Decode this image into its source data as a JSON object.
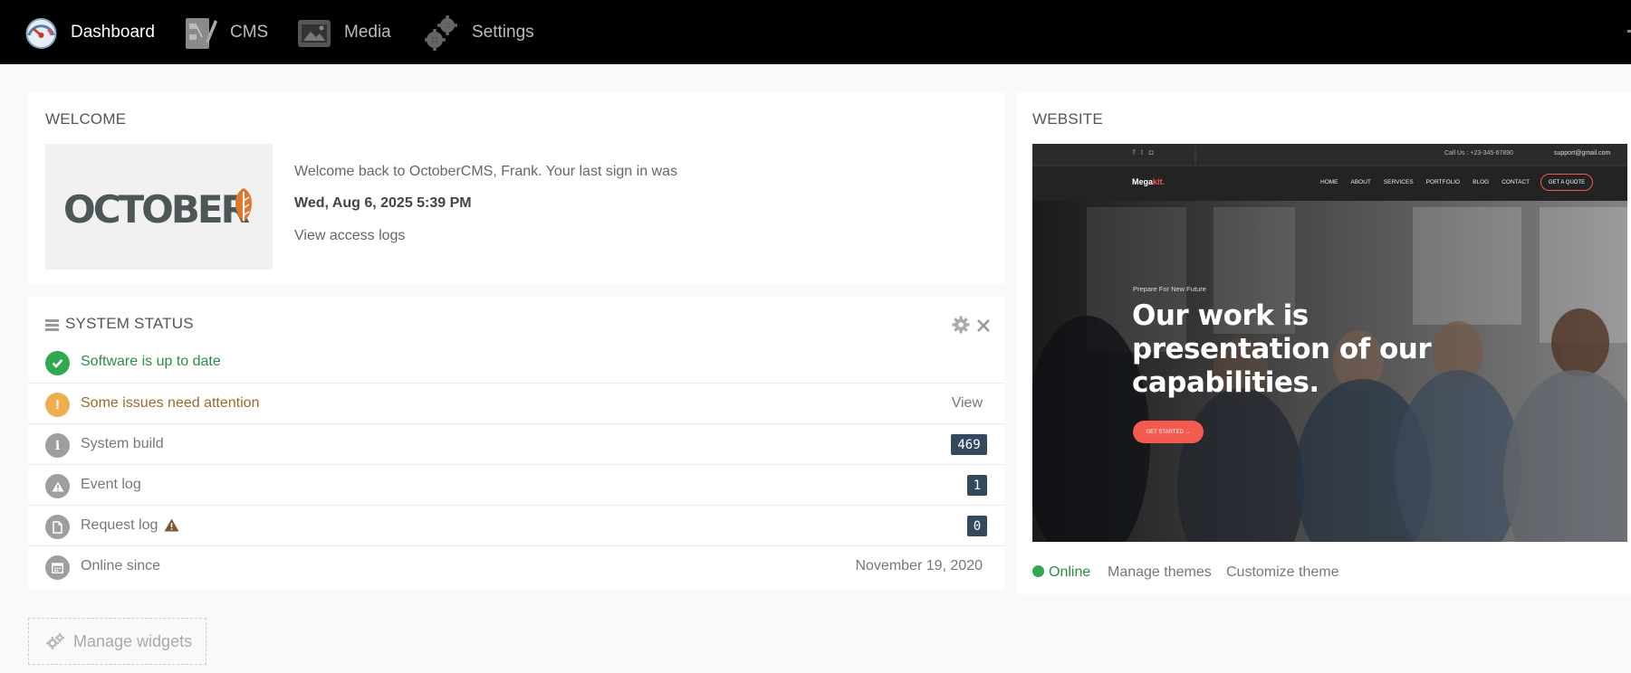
{
  "nav": {
    "items": [
      {
        "label": "Dashboard",
        "icon": "speedometer-icon"
      },
      {
        "label": "CMS",
        "icon": "cms-icon"
      },
      {
        "label": "Media",
        "icon": "media-icon"
      },
      {
        "label": "Settings",
        "icon": "gears-icon"
      }
    ]
  },
  "welcome": {
    "title": "WELCOME",
    "logo_text": "OCTOBER",
    "message": "Welcome back to OctoberCMS, Frank. Your last sign in was",
    "last_signin": "Wed, Aug 6, 2025 5:39 PM",
    "access_logs_link": "View access logs"
  },
  "system_status": {
    "title": "SYSTEM STATUS",
    "rows": [
      {
        "label": "Software is up to date",
        "icon": "check-icon"
      },
      {
        "label": "Some issues need attention",
        "icon": "exclamation-icon",
        "right": "View"
      },
      {
        "label": "System build",
        "icon": "info-icon",
        "badge": "469"
      },
      {
        "label": "Event log",
        "icon": "warning-icon",
        "badge": "1"
      },
      {
        "label": "Request log",
        "icon": "file-icon",
        "badge": "0"
      },
      {
        "label": "Online since",
        "icon": "calendar-icon",
        "right": "November 19, 2020"
      }
    ]
  },
  "website": {
    "title": "WEBSITE",
    "preview": {
      "contact_phone": "Call Us : +23-345-67890",
      "contact_email": "support@gmail.com",
      "brand_a": "Mega",
      "brand_b": "kit.",
      "menu": [
        "HOME",
        "ABOUT",
        "SERVICES",
        "PORTFOLIO",
        "BLOG",
        "CONTACT"
      ],
      "cta": "GET A QUOTE",
      "kicker": "Prepare For New Future",
      "headline_1": "Our work is",
      "headline_2": "presentation of our",
      "headline_3": "capabilities.",
      "button": "GET STARTED →"
    },
    "status": "Online",
    "manage_themes": "Manage themes",
    "customize_theme": "Customize theme"
  },
  "manage_widgets": "Manage widgets",
  "colors": {
    "success": "#2fa84f",
    "warning": "#f0ad4e",
    "muted": "#9e9e9e",
    "badge": "#34495e",
    "brand_accent": "#f55a4e"
  }
}
